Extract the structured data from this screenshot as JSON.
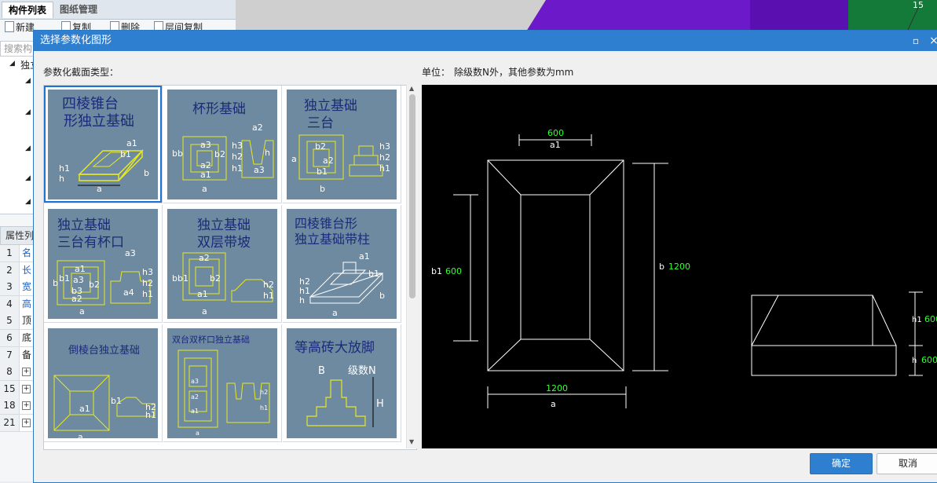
{
  "background": {
    "left_tabs": [
      {
        "label": "构件列表",
        "active": true
      },
      {
        "label": "图纸管理",
        "active": false
      }
    ],
    "toolbar": {
      "new": "新建",
      "copy": "复制",
      "delete": "删除",
      "copy_between_floors": "层间复制"
    },
    "search_placeholder": "搜索构",
    "tree_item": "独立",
    "property_tab": "属性列",
    "property_rows": [
      {
        "num": "1",
        "text": "名"
      },
      {
        "num": "2",
        "text": "长"
      },
      {
        "num": "3",
        "text": "宽"
      },
      {
        "num": "4",
        "text": "高"
      },
      {
        "num": "5",
        "text": "顶"
      },
      {
        "num": "6",
        "text": "底"
      },
      {
        "num": "7",
        "text": "备"
      },
      {
        "num": "8",
        "text": "+"
      },
      {
        "num": "15",
        "text": "+"
      },
      {
        "num": "18",
        "text": "+"
      },
      {
        "num": "21",
        "text": "+"
      }
    ],
    "viewport_corner_text": "15"
  },
  "dialog": {
    "title": "选择参数化图形",
    "section_type_label": "参数化截面类型：",
    "unit_label": "单位：",
    "unit_text": "除级数N外，其他参数为mm",
    "shapes": [
      {
        "title": "四棱锥台形独立基础",
        "line1": "四棱锥台",
        "line2": "形独立基础",
        "selected": true
      },
      {
        "title": "杯形基础",
        "line1": "杯形基础",
        "line2": "",
        "selected": false
      },
      {
        "title": "独立基础三台",
        "line1": "独立基础",
        "line2": "三台",
        "selected": false
      },
      {
        "title": "独立基础三台有杯口",
        "line1": "独立基础",
        "line2": "三台有杯口",
        "selected": false
      },
      {
        "title": "独立基础双层带坡",
        "line1": "独立基础",
        "line2": "双层带坡",
        "selected": false
      },
      {
        "title": "四棱锥台形独立基础带柱",
        "line1": "四棱锥台形",
        "line2": "独立基础带柱",
        "selected": false
      },
      {
        "title": "倒棱台独立基础",
        "line1": "倒棱台独立基础",
        "line2": "",
        "selected": false
      },
      {
        "title": "双台双杯口独立基础",
        "line1": "双台双杯口独立基础",
        "line2": "",
        "selected": false
      },
      {
        "title": "等高砖大放脚",
        "line1": "等高砖大放脚",
        "line2": "",
        "selected": false
      }
    ],
    "preview": {
      "a1_value": "600",
      "a1_label": "a1",
      "b1_label": "b1",
      "b1_value": "600",
      "b_label": "b",
      "b_value": "1200",
      "a_value": "1200",
      "a_label": "a",
      "h1_label": "h1",
      "h1_value": "600",
      "h_label": "h",
      "h_value": "600"
    },
    "ok_label": "确定",
    "cancel_label": "取消",
    "colors": {
      "title_bar": "#2f7fd0",
      "preview_bg": "#000000",
      "dim_value": "#33ff33",
      "thumb_bg": "#6e8aa0"
    }
  }
}
